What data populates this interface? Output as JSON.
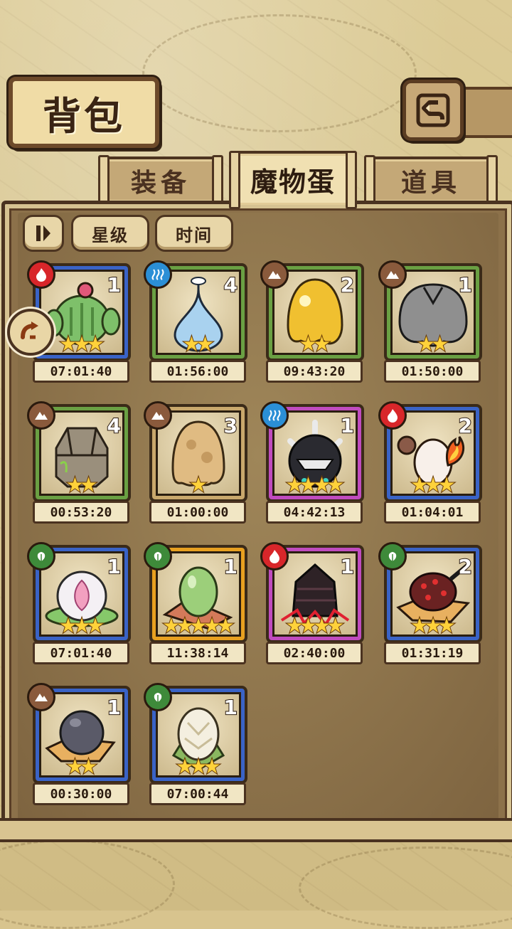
{
  "header": {
    "title": "背包",
    "back_icon": "back-arrow-icon"
  },
  "tabs": [
    {
      "label": "装备",
      "active": false
    },
    {
      "label": "魔物蛋",
      "active": true
    },
    {
      "label": "道具",
      "active": false
    }
  ],
  "sort": {
    "toggle_icon": "sort-toggle-icon",
    "star_label": "星级",
    "time_label": "时间"
  },
  "colors": {
    "fire": "#d8262a",
    "water": "#2b8fd6",
    "earth": "#8a5a3c",
    "nature": "#3e8a3a",
    "rare_green": "#6aa043",
    "rare_blue": "#3a63c6",
    "rare_purple": "#c04bbf",
    "rare_gold": "#e8a020"
  },
  "eggs": [
    {
      "element": "fire",
      "count": "1",
      "stars": "★★★",
      "timer": "07:01:40"
    },
    {
      "element": "water",
      "count": "4",
      "stars": "★★",
      "timer": "01:56:00"
    },
    {
      "element": "earth",
      "count": "2",
      "stars": "★★",
      "timer": "09:43:20"
    },
    {
      "element": "earth",
      "count": "1",
      "stars": "★★",
      "timer": "01:50:00"
    },
    {
      "element": "earth",
      "count": "4",
      "stars": "★★",
      "timer": "00:53:20"
    },
    {
      "element": "earth",
      "count": "3",
      "stars": "★",
      "timer": "01:00:00"
    },
    {
      "element": "water",
      "count": "1",
      "stars": "★★★★",
      "timer": "04:42:13"
    },
    {
      "element": "fire",
      "count": "2",
      "stars": "★★★",
      "timer": "01:04:01"
    },
    {
      "element": "nature",
      "count": "1",
      "stars": "★★★",
      "timer": "07:01:40"
    },
    {
      "element": "nature",
      "count": "1",
      "stars": "★★★★★",
      "timer": "11:38:14"
    },
    {
      "element": "fire",
      "count": "1",
      "stars": "★★★★",
      "timer": "02:40:00"
    },
    {
      "element": "nature",
      "count": "2",
      "stars": "★★★",
      "timer": "01:31:19"
    },
    {
      "element": "earth",
      "count": "1",
      "stars": "★★",
      "timer": "00:30:00"
    },
    {
      "element": "nature",
      "count": "1",
      "stars": "★★★",
      "timer": "07:00:44"
    }
  ]
}
